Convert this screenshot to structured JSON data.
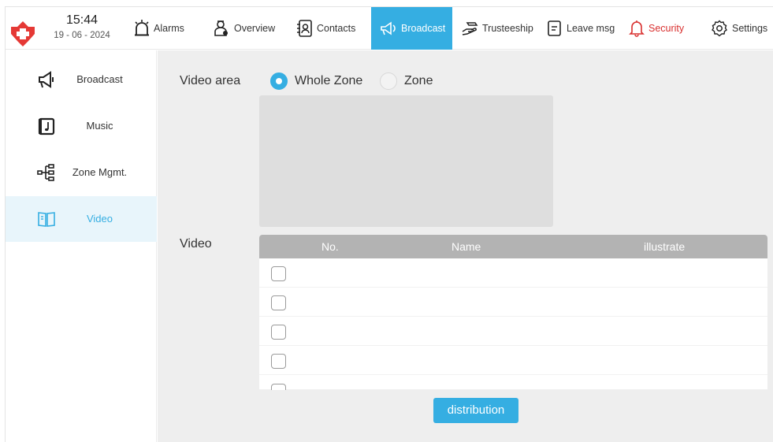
{
  "header": {
    "time": "15:44",
    "date": "19 - 06 - 2024",
    "logo_icon": "red-cross-logo-icon"
  },
  "nav": {
    "alarms": "Alarms",
    "overview": "Overview",
    "contacts": "Contacts",
    "broadcast": "Broadcast",
    "trusteeship": "Trusteeship",
    "leave_msg": "Leave msg",
    "security": "Security",
    "settings": "Settings"
  },
  "sidebar": {
    "items": [
      {
        "label": "Broadcast",
        "icon": "megaphone-icon"
      },
      {
        "label": "Music",
        "icon": "music-note-icon"
      },
      {
        "label": "Zone Mgmt.",
        "icon": "zone-tree-icon"
      },
      {
        "label": "Video",
        "icon": "book-icon",
        "active": true
      }
    ]
  },
  "main": {
    "video_area_label": "Video area",
    "radio_whole_zone": "Whole Zone",
    "radio_zone": "Zone",
    "selected_area": "Whole Zone",
    "video_label": "Video",
    "table": {
      "columns": [
        "No.",
        "Name",
        "illustrate"
      ],
      "rows": [
        {
          "checked": false
        },
        {
          "checked": false
        },
        {
          "checked": false
        },
        {
          "checked": false
        },
        {
          "checked": false
        }
      ]
    },
    "distribution_button": "distribution"
  },
  "colors": {
    "accent": "#35aee2",
    "security": "#d9302f",
    "main_bg": "#eeeeee",
    "table_header": "#b3b3b3"
  }
}
